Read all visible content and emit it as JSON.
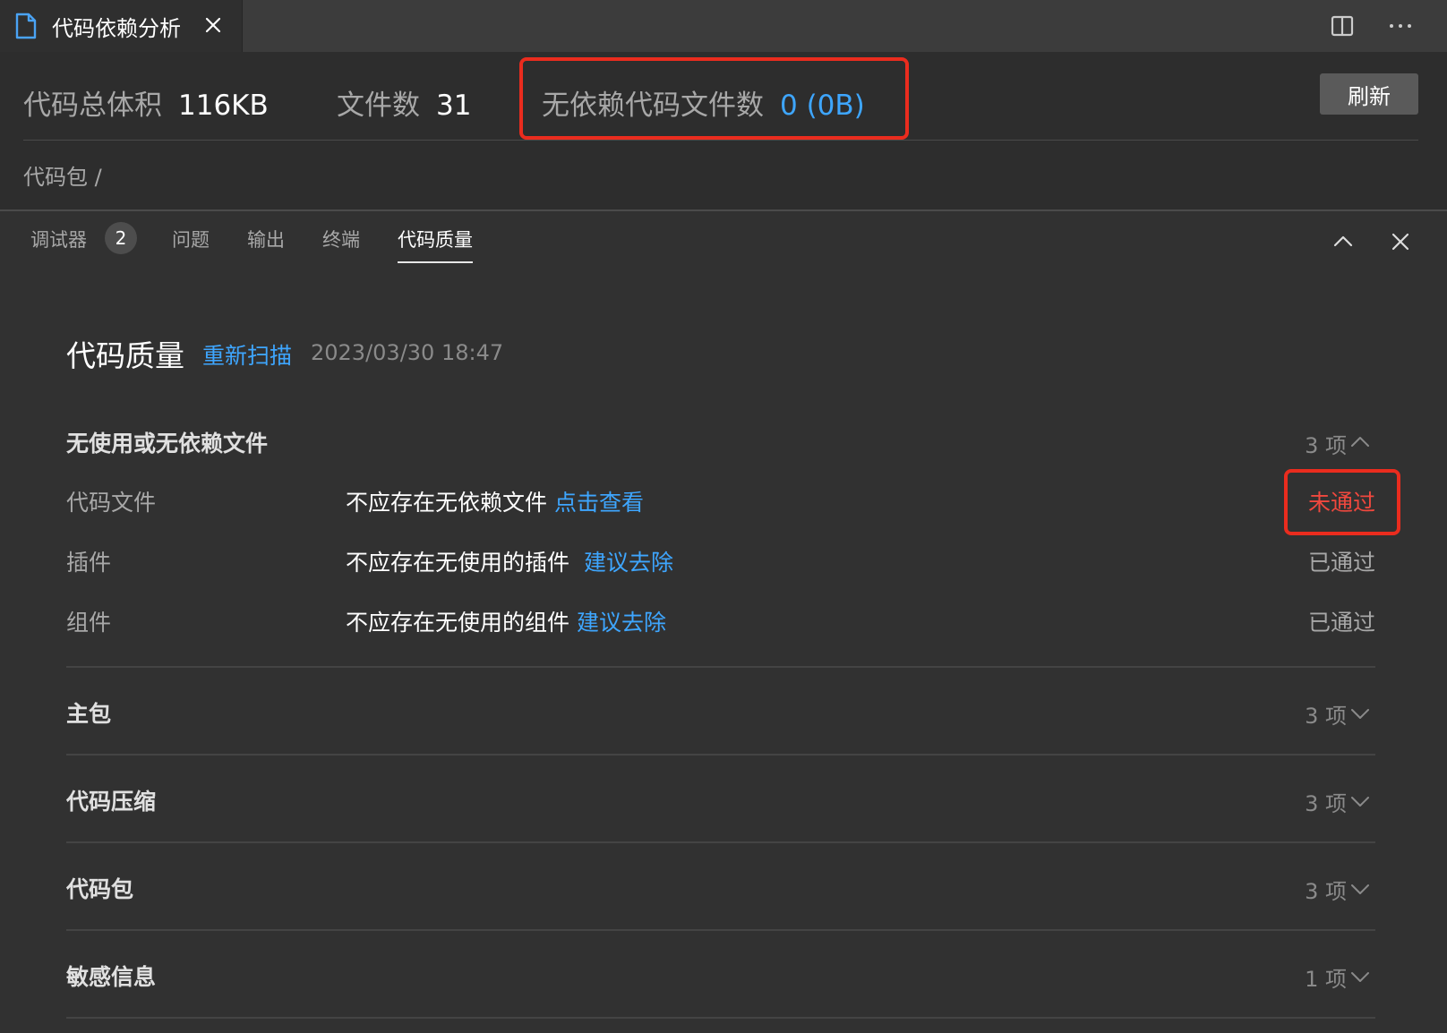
{
  "tab": {
    "title": "代码依赖分析"
  },
  "summary": {
    "total_size_label": "代码总体积",
    "total_size_value": "116KB",
    "file_count_label": "文件数",
    "file_count_value": "31",
    "unused_files_label": "无依赖代码文件数",
    "unused_files_value": "0 (0B)",
    "refresh_label": "刷新",
    "breadcrumb": "代码包 /"
  },
  "panel": {
    "tabs": [
      {
        "label": "调试器",
        "badge": "2"
      },
      {
        "label": "问题"
      },
      {
        "label": "输出"
      },
      {
        "label": "终端"
      },
      {
        "label": "代码质量",
        "active": true
      }
    ]
  },
  "quality": {
    "title": "代码质量",
    "rescan_label": "重新扫描",
    "timestamp": "2023/03/30 18:47",
    "sections": [
      {
        "title": "无使用或无依赖文件",
        "count": "3 项",
        "expanded": true,
        "rows": [
          {
            "label": "代码文件",
            "desc": "不应存在无依赖文件",
            "link": "点击查看",
            "status": "未通过"
          },
          {
            "label": "插件",
            "desc": "不应存在无使用的插件",
            "link": "建议去除",
            "status": "已通过"
          },
          {
            "label": "组件",
            "desc": "不应存在无使用的组件",
            "link": "建议去除",
            "status": "已通过"
          }
        ]
      },
      {
        "title": "主包",
        "count": "3 项",
        "expanded": false
      },
      {
        "title": "代码压缩",
        "count": "3 项",
        "expanded": false
      },
      {
        "title": "代码包",
        "count": "3 项",
        "expanded": false
      },
      {
        "title": "敏感信息",
        "count": "1 项",
        "expanded": false
      }
    ]
  },
  "colors": {
    "link": "#3ea6ff",
    "fail": "#f0483e",
    "highlight": "#ea2c1e",
    "background": "#313131"
  },
  "icons": {
    "tab": "file-icon",
    "tab_close": "close-icon",
    "split": "split-editor-icon",
    "more": "more-actions-icon",
    "panel_collapse": "chevron-up-icon",
    "panel_close": "close-icon",
    "section_expanded": "chevron-up-icon",
    "section_collapsed": "chevron-down-icon"
  }
}
